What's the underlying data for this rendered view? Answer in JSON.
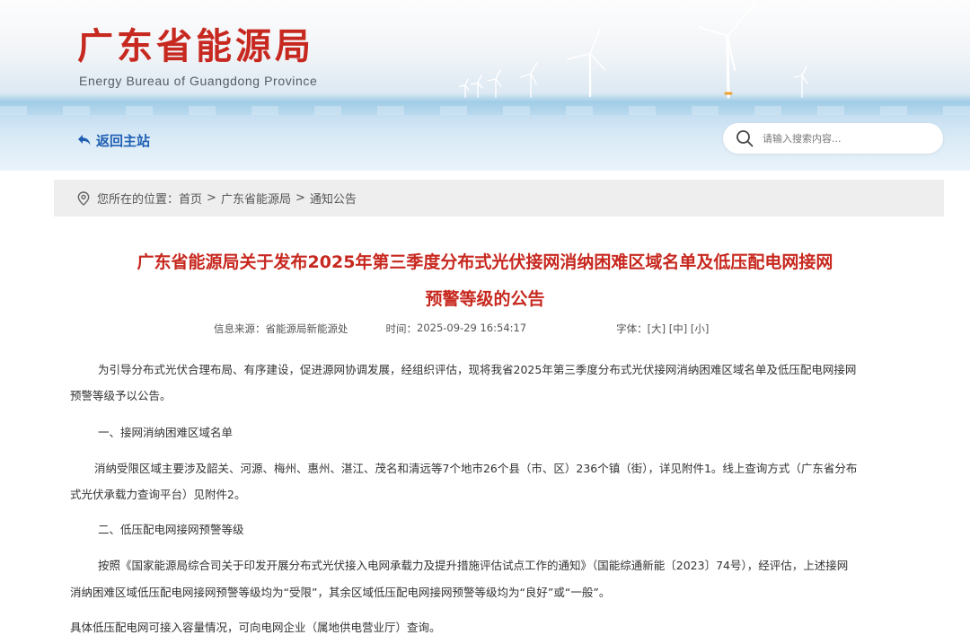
{
  "header": {
    "logo_title": "广东省能源局",
    "logo_subtitle": "Energy Bureau of Guangdong Province",
    "back_link": "返回主站",
    "search_placeholder": "请输入搜索内容..."
  },
  "colors": {
    "title_red": "#c7281f",
    "link_blue": "#1f5fb3",
    "breadcrumb_bg": "#eeeeee"
  },
  "breadcrumb": {
    "label": "您所在的位置：",
    "items": [
      "首页",
      "广东省能源局",
      "通知公告"
    ],
    "separator": ">"
  },
  "article": {
    "title_line1": "广东省能源局关于发布2025年第三季度分布式光伏接网消纳困难区域名单及低压配电网接网",
    "title_line2": "预警等级的公告",
    "meta": {
      "source_label": "信息来源：",
      "source": "省能源局新能源处",
      "time_label": "时间：",
      "time": "2025-09-29 16:54:17",
      "font_label": "字体：",
      "font_large": "[大]",
      "font_medium": "[中]",
      "font_small": "[小]"
    },
    "p1_line1": "为引导分布式光伏合理布局、有序建设，促进源网协调发展，经组织评估，现将我省2025年第三季度分布式光伏接网消纳困难区域名单及低压配电网接网",
    "p1_line2": "预警等级予以公告。",
    "h1": "一、接网消纳困难区域名单",
    "p2_line1": "消纳受限区域主要涉及韶关、河源、梅州、惠州、湛江、茂名和清远等7个地市26个县（市、区）236个镇（街），详见附件1。线上查询方式（广东省分布",
    "p2_line2": "式光伏承载力查询平台）见附件2。",
    "h2": "二、低压配电网接网预警等级",
    "p3_line1": "按照《国家能源局综合司关于印发开展分布式光伏接入电网承载力及提升措施评估试点工作的通知》（国能综通新能〔2023〕74号），经评估，上述接网",
    "p3_line2": "消纳困难区域低压配电网接网预警等级均为“受限”，其余区域低压配电网接网预警等级均为“良好”或“一般”。",
    "p4_line1": "具体低压配电网可接入容量情况，可向电网企业（属地供电营业厅）查询。"
  }
}
